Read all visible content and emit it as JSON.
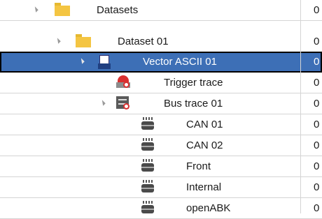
{
  "tree": {
    "rows": [
      {
        "label": "Datasets",
        "value": "0",
        "icon": "folder-icon",
        "expanded": true
      },
      {
        "label": "Dataset 01",
        "value": "0",
        "icon": "folder-icon",
        "expanded": true
      },
      {
        "label": "Vector ASCII 01",
        "value": "0",
        "icon": "ascii-file-icon",
        "icon_text": "ASCII",
        "expanded": true,
        "selected": true
      },
      {
        "label": "Trigger trace",
        "value": "0",
        "icon": "trigger-trace-icon"
      },
      {
        "label": "Bus trace 01",
        "value": "0",
        "icon": "bus-trace-icon",
        "expanded": true
      },
      {
        "label": "CAN 01",
        "value": "0",
        "icon": "channel-icon"
      },
      {
        "label": "CAN 02",
        "value": "0",
        "icon": "channel-icon"
      },
      {
        "label": "Front",
        "value": "0",
        "icon": "channel-icon"
      },
      {
        "label": "Internal",
        "value": "0",
        "icon": "channel-icon"
      },
      {
        "label": "openABK",
        "value": "0",
        "icon": "channel-icon"
      }
    ]
  },
  "colors": {
    "selection": "#3d6fb6",
    "folder": "#f4c542",
    "grid": "#d4d4d4"
  }
}
